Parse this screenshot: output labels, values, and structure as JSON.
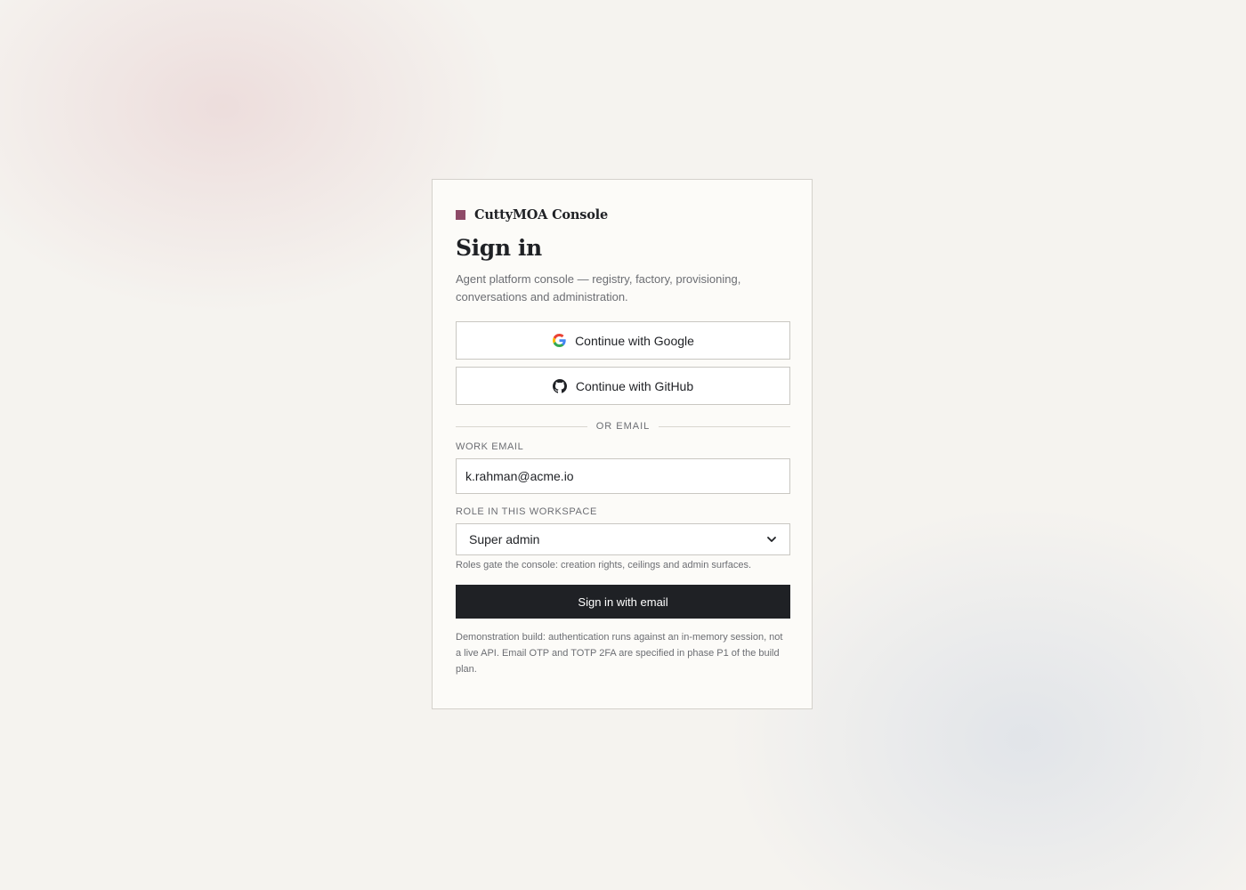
{
  "brand": {
    "name": "CuttyMOA Console",
    "mark_color": "#8e4a68"
  },
  "page": {
    "title": "Sign in",
    "subtitle": "Agent platform console — registry, factory, provisioning, conversations and administration."
  },
  "oauth": {
    "google_label": "Continue with Google",
    "google_icon": "google-icon",
    "github_label": "Continue with GitHub",
    "github_icon": "github-icon"
  },
  "divider": {
    "label": "OR EMAIL"
  },
  "email": {
    "label": "WORK EMAIL",
    "value": "k.rahman@acme.io"
  },
  "role": {
    "label": "ROLE IN THIS WORKSPACE",
    "selected": "Super admin",
    "hint": "Roles gate the console: creation rights, ceilings and admin surfaces."
  },
  "submit": {
    "label": "Sign in with email",
    "color": "#1f2125"
  },
  "footnote": "Demonstration build: authentication runs against an in-memory session, not a live API. Email OTP and TOTP 2FA are specified in phase P1 of the build plan."
}
